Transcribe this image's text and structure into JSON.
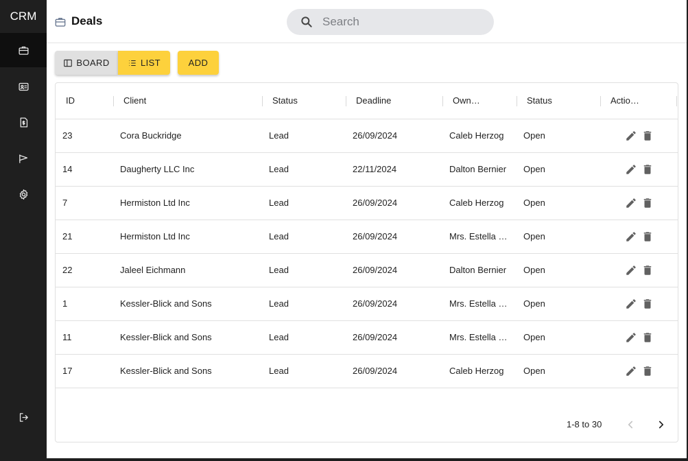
{
  "app": {
    "brand": "CRM"
  },
  "sidebar": {
    "items": [
      {
        "name": "deals",
        "icon": "briefcase-icon",
        "active": true
      },
      {
        "name": "contacts",
        "icon": "contact-card-icon",
        "active": false
      },
      {
        "name": "invoices",
        "icon": "invoice-icon",
        "active": false
      },
      {
        "name": "campaigns",
        "icon": "flag-icon",
        "active": false
      },
      {
        "name": "settings",
        "icon": "gear-icon",
        "active": false
      }
    ],
    "logout_icon": "logout-icon"
  },
  "header": {
    "title": "Deals",
    "title_icon": "briefcase-icon",
    "search_placeholder": "Search"
  },
  "toolbar": {
    "board_label": "BOARD",
    "list_label": "LIST",
    "add_label": "ADD",
    "active_view": "list"
  },
  "table": {
    "columns": [
      "ID",
      "Client",
      "Status",
      "Deadline",
      "Own…",
      "Status",
      "Actio…"
    ],
    "rows": [
      {
        "id": "23",
        "client": "Cora Buckridge",
        "stage": "Lead",
        "deadline": "26/09/2024",
        "owner": "Caleb Herzog",
        "status": "Open"
      },
      {
        "id": "14",
        "client": "Daugherty LLC Inc",
        "stage": "Lead",
        "deadline": "22/11/2024",
        "owner": "Dalton Bernier",
        "status": "Open"
      },
      {
        "id": "7",
        "client": "Hermiston Ltd Inc",
        "stage": "Lead",
        "deadline": "26/09/2024",
        "owner": "Caleb Herzog",
        "status": "Open"
      },
      {
        "id": "21",
        "client": "Hermiston Ltd Inc",
        "stage": "Lead",
        "deadline": "26/09/2024",
        "owner": "Mrs. Estella …",
        "status": "Open"
      },
      {
        "id": "22",
        "client": "Jaleel Eichmann",
        "stage": "Lead",
        "deadline": "26/09/2024",
        "owner": "Dalton Bernier",
        "status": "Open"
      },
      {
        "id": "1",
        "client": "Kessler-Blick and Sons",
        "stage": "Lead",
        "deadline": "26/09/2024",
        "owner": "Mrs. Estella …",
        "status": "Open"
      },
      {
        "id": "11",
        "client": "Kessler-Blick and Sons",
        "stage": "Lead",
        "deadline": "26/09/2024",
        "owner": "Mrs. Estella …",
        "status": "Open"
      },
      {
        "id": "17",
        "client": "Kessler-Blick and Sons",
        "stage": "Lead",
        "deadline": "26/09/2024",
        "owner": "Caleb Herzog",
        "status": "Open"
      }
    ],
    "row_actions": [
      "edit-icon",
      "delete-icon"
    ]
  },
  "pagination": {
    "range_text": "1-8 to 30",
    "prev_icon": "chevron-left-icon",
    "next_icon": "chevron-right-icon"
  },
  "colors": {
    "sidebar_bg": "#1f1f1f",
    "accent": "#fdd13c",
    "toggle_inactive": "#e0e0e0"
  }
}
